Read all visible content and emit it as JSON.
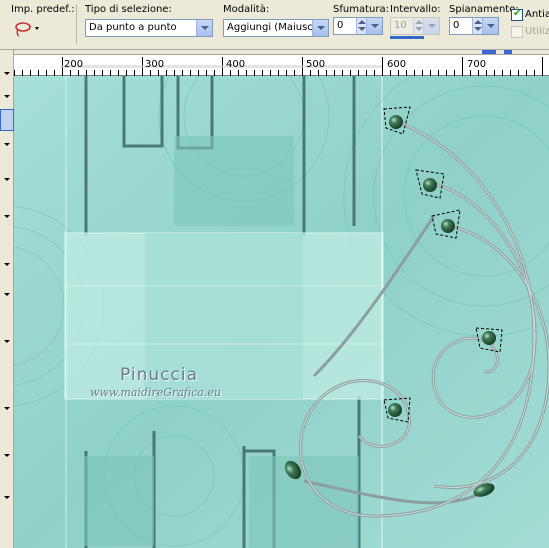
{
  "toolbar": {
    "preset": {
      "label": "Imp. predef.:"
    },
    "selection_type": {
      "label": "Tipo di selezione:",
      "value": "Da punto a punto"
    },
    "mode": {
      "label": "Modalità:",
      "value": "Aggiungi (Maiusc)"
    },
    "feather": {
      "label": "Sfumatura:",
      "value": "0"
    },
    "range": {
      "label": "Intervallo:",
      "value": "10"
    },
    "smoothing": {
      "label": "Spianamento:",
      "value": "0"
    },
    "antialias": {
      "label": "Antial",
      "checked": true
    },
    "use_all_layers": {
      "label": "Utilizz",
      "checked": false
    }
  },
  "ruler": {
    "labels": [
      "200",
      "300",
      "400",
      "500",
      "600",
      "700"
    ]
  },
  "canvas": {
    "watermark_title": "Pinuccia",
    "watermark_url": "www.maidireGrafica.eu"
  },
  "colors": {
    "teal_background": "#9bd8d0",
    "panel": "#ece9d8",
    "ruler_accent": "#3a66d6",
    "bead": "#2f5a3c"
  }
}
